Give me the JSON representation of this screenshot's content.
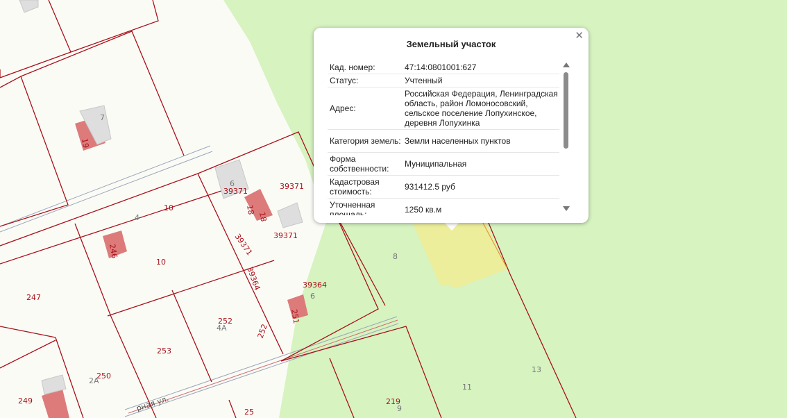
{
  "popup": {
    "title": "Земельный участок",
    "close_icon": "close-icon",
    "rows": [
      {
        "key": "Кад. номер:",
        "value": "47:14:0801001:627"
      },
      {
        "key": "Статус:",
        "value": "Учтенный"
      },
      {
        "key": "Адрес:",
        "value": "Российская Федерация, Ленинградская область, район Ломоносовский, сельское поселение Лопухинское, деревня Лопухинка"
      },
      {
        "key": "Категория земель:",
        "value": "Земли населенных пунктов"
      },
      {
        "key": "Форма собственности:",
        "value": "Муниципальная"
      },
      {
        "key": "Кадастровая стоимость:",
        "value": "931412.5 руб"
      },
      {
        "key": "Уточненная площадь:",
        "value": "1250 кв.м"
      }
    ]
  },
  "map": {
    "colors": {
      "background": "#fbfbf6",
      "green_zone": "#d6f3c0",
      "boundary": "#a8111a",
      "building": "#dd7b7b",
      "selected": "#ecee9c"
    },
    "red_labels": [
      "39371",
      "39371",
      "39371",
      "39371",
      "39364",
      "39364",
      "10",
      "10",
      "247",
      "252",
      "252",
      "253",
      "250",
      "249",
      "25",
      "219",
      "19",
      "18",
      "18",
      "246",
      "251"
    ],
    "grey_labels": [
      "7",
      "6",
      "4",
      "8",
      "6",
      "4А",
      "2А",
      "11",
      "13",
      "9"
    ],
    "street_label": "рная ул."
  }
}
